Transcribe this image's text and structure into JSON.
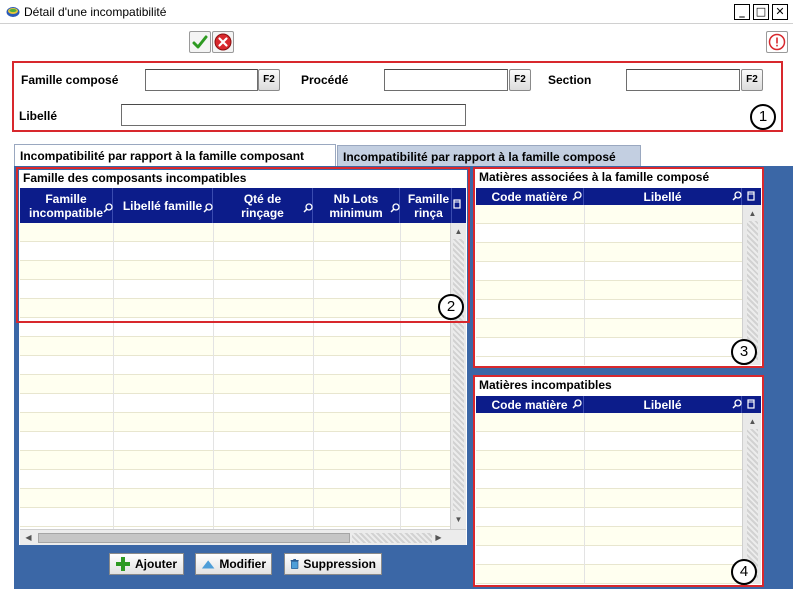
{
  "window": {
    "title": "Détail d'une incompatibilité",
    "minimize": "_",
    "maximize": "□",
    "close": "✕"
  },
  "toolbar": {
    "validate_icon": "check-icon",
    "cancel_icon": "cancel-icon",
    "info_icon": "info-icon"
  },
  "header": {
    "famille_compose_label": "Famille composé",
    "famille_compose_value": "",
    "procede_label": "Procédé",
    "procede_value": "",
    "section_label": "Section",
    "section_value": "",
    "libelle_label": "Libellé",
    "libelle_value": "",
    "f2": "F2",
    "marker": "1"
  },
  "tabs": [
    {
      "label": "Incompatibilité par rapport à la famille composant",
      "active": true
    },
    {
      "label": "Incompatibilité par rapport à la famille composé",
      "active": false
    }
  ],
  "familles_grid": {
    "title": "Famille des composants incompatibles",
    "columns": [
      "Famille incompatible",
      "Libellé famille",
      "Qté de rinçage",
      "Nb Lots minimum",
      "Famille rinça"
    ],
    "marker": "2"
  },
  "matieres_associees": {
    "title": "Matières associées à la famille composé",
    "columns": [
      "Code matière",
      "Libellé"
    ],
    "marker": "3"
  },
  "matieres_incompatibles": {
    "title": "Matières incompatibles",
    "columns": [
      "Code matière",
      "Libellé"
    ],
    "marker": "4"
  },
  "actions": {
    "add": "Ajouter",
    "edit": "Modifier",
    "delete": "Suppression"
  },
  "colors": {
    "panel_bg": "#3b67a6",
    "grid_header": "#0c1c8a",
    "highlight_border": "#d8282d",
    "row_alt": "#fffff0"
  }
}
